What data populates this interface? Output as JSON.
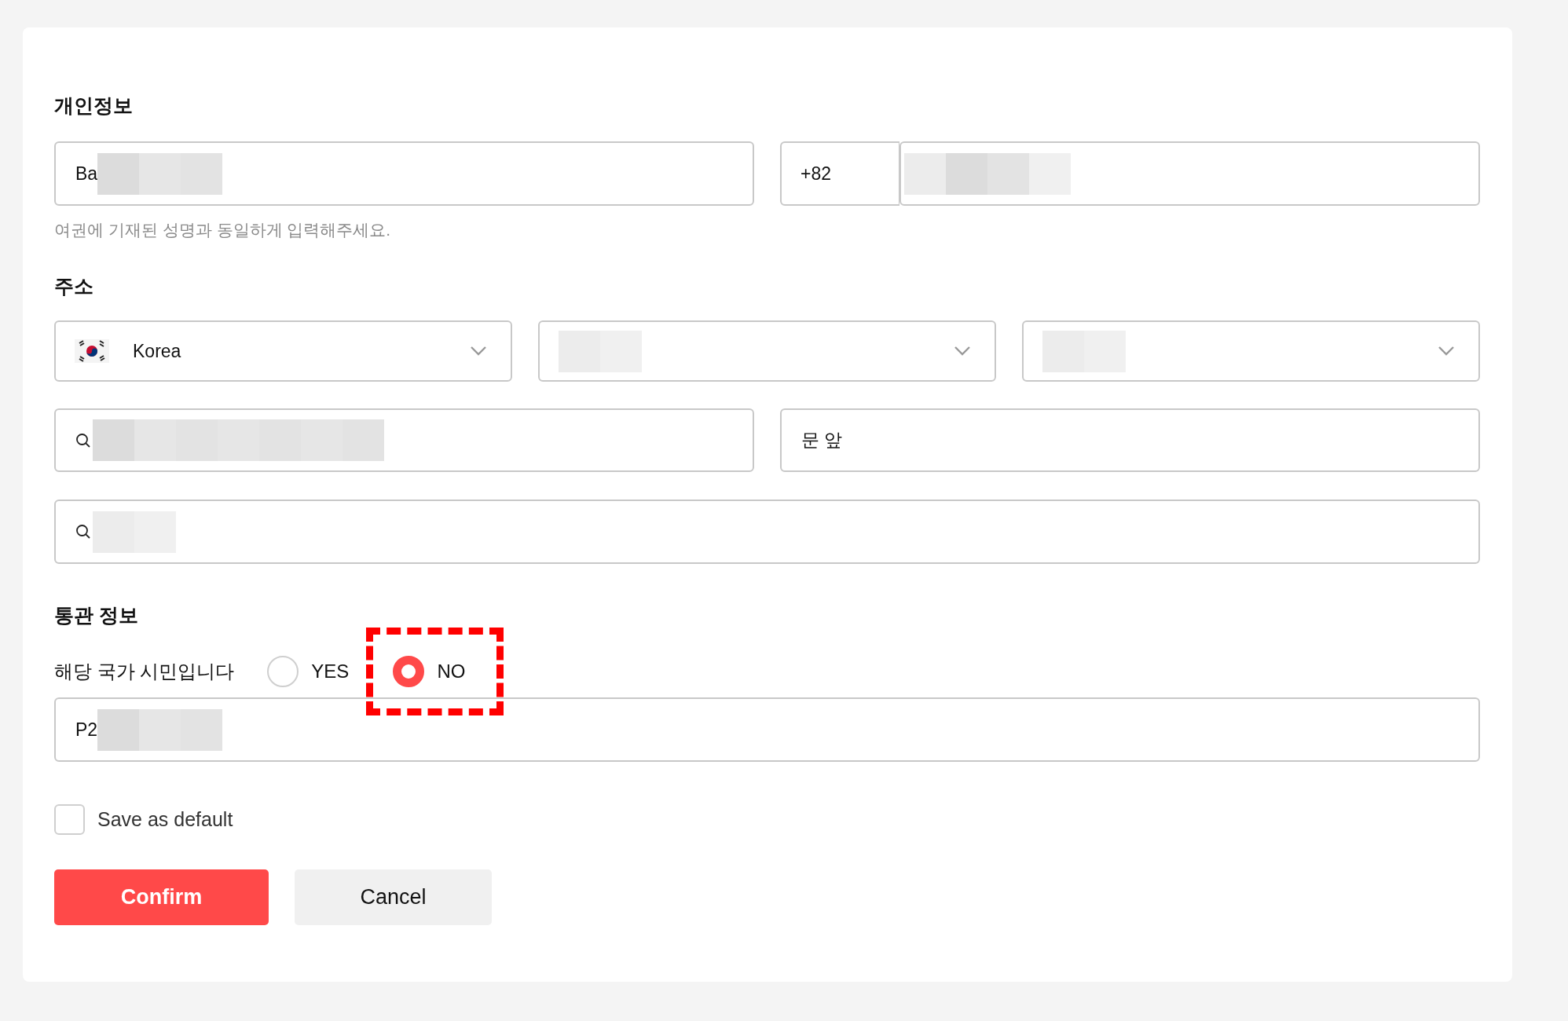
{
  "personal_info": {
    "heading": "개인정보",
    "name_field": {
      "value": "Ba",
      "redacted": true
    },
    "phone": {
      "country_code": "+82",
      "number_redacted": true
    },
    "hint": "여권에 기재된 성명과 동일하게 입력해주세요."
  },
  "address": {
    "heading": "주소",
    "selects": [
      {
        "value": "Korea",
        "flag": true,
        "redacted": false
      },
      {
        "redacted": true
      },
      {
        "redacted": true
      }
    ],
    "rows": [
      [
        {
          "kind": "search",
          "redacted": true
        },
        {
          "kind": "text",
          "value": "문 앞",
          "redacted": false
        }
      ],
      [
        {
          "kind": "search",
          "redacted": true
        }
      ]
    ]
  },
  "customs": {
    "heading": "통관 정보",
    "question": "해당 국가 시민입니다",
    "options": [
      {
        "label": "YES",
        "selected": false,
        "highlighted": false
      },
      {
        "label": "NO",
        "selected": true,
        "highlighted": true
      }
    ],
    "passport_field": {
      "value": "P2",
      "redacted": true
    }
  },
  "save_default": {
    "label": "Save as default",
    "checked": false
  },
  "buttons": [
    {
      "label": "Confirm",
      "kind": "primary"
    },
    {
      "label": "Cancel",
      "kind": "secondary"
    }
  ]
}
